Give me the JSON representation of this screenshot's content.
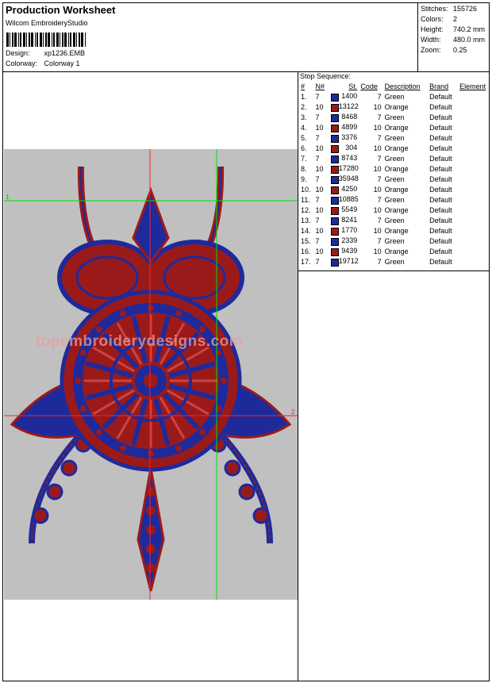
{
  "header": {
    "title": "Production Worksheet",
    "subtitle": "Wilcom EmbroideryStudio",
    "design_label": "Design:",
    "design_value": "xp1236.EMB",
    "colorway_label": "Colorway:",
    "colorway_value": "Colorway 1"
  },
  "stats": {
    "stitches_label": "Stitches:",
    "stitches_value": "155726",
    "colors_label": "Colors:",
    "colors_value": "2",
    "height_label": "Height:",
    "height_value": "740.2 mm",
    "width_label": "Width:",
    "width_value": "480.0 mm",
    "zoom_label": "Zoom:",
    "zoom_value": "0.25"
  },
  "stop_sequence": {
    "caption": "Stop Sequence:",
    "headers": [
      "#",
      "N#",
      "St.",
      "Code",
      "Description",
      "Brand",
      "Element"
    ],
    "rows": [
      {
        "idx": "1.",
        "n": "7",
        "color": "#1e2a9c",
        "st": "1400",
        "code": "7",
        "desc": "Green",
        "brand": "Default"
      },
      {
        "idx": "2.",
        "n": "10",
        "color": "#9a1a1a",
        "st": "13122",
        "code": "10",
        "desc": "Orange",
        "brand": "Default"
      },
      {
        "idx": "3.",
        "n": "7",
        "color": "#1e2a9c",
        "st": "8468",
        "code": "7",
        "desc": "Green",
        "brand": "Default"
      },
      {
        "idx": "4.",
        "n": "10",
        "color": "#9a1a1a",
        "st": "4899",
        "code": "10",
        "desc": "Orange",
        "brand": "Default"
      },
      {
        "idx": "5.",
        "n": "7",
        "color": "#1e2a9c",
        "st": "3376",
        "code": "7",
        "desc": "Green",
        "brand": "Default"
      },
      {
        "idx": "6.",
        "n": "10",
        "color": "#9a1a1a",
        "st": "304",
        "code": "10",
        "desc": "Orange",
        "brand": "Default"
      },
      {
        "idx": "7.",
        "n": "7",
        "color": "#1e2a9c",
        "st": "8743",
        "code": "7",
        "desc": "Green",
        "brand": "Default"
      },
      {
        "idx": "8.",
        "n": "10",
        "color": "#9a1a1a",
        "st": "17280",
        "code": "10",
        "desc": "Orange",
        "brand": "Default"
      },
      {
        "idx": "9.",
        "n": "7",
        "color": "#1e2a9c",
        "st": "35948",
        "code": "7",
        "desc": "Green",
        "brand": "Default"
      },
      {
        "idx": "10.",
        "n": "10",
        "color": "#9a1a1a",
        "st": "4250",
        "code": "10",
        "desc": "Orange",
        "brand": "Default"
      },
      {
        "idx": "11.",
        "n": "7",
        "color": "#1e2a9c",
        "st": "10885",
        "code": "7",
        "desc": "Green",
        "brand": "Default"
      },
      {
        "idx": "12.",
        "n": "10",
        "color": "#9a1a1a",
        "st": "5549",
        "code": "10",
        "desc": "Orange",
        "brand": "Default"
      },
      {
        "idx": "13.",
        "n": "7",
        "color": "#1e2a9c",
        "st": "8241",
        "code": "7",
        "desc": "Green",
        "brand": "Default"
      },
      {
        "idx": "14.",
        "n": "10",
        "color": "#9a1a1a",
        "st": "1770",
        "code": "10",
        "desc": "Orange",
        "brand": "Default"
      },
      {
        "idx": "15.",
        "n": "7",
        "color": "#1e2a9c",
        "st": "2339",
        "code": "7",
        "desc": "Green",
        "brand": "Default"
      },
      {
        "idx": "16.",
        "n": "10",
        "color": "#9a1a1a",
        "st": "9439",
        "code": "10",
        "desc": "Orange",
        "brand": "Default"
      },
      {
        "idx": "17.",
        "n": "7",
        "color": "#1e2a9c",
        "st": "19712",
        "code": "7",
        "desc": "Green",
        "brand": "Default"
      }
    ]
  },
  "design_view": {
    "guide_label_1": "1",
    "guide_label_2": "2",
    "watermark": "topembroiderydesigns.com",
    "thread_blue": "#1e2a9c",
    "thread_red": "#9a1a1a",
    "background": "#c0c0c0"
  }
}
